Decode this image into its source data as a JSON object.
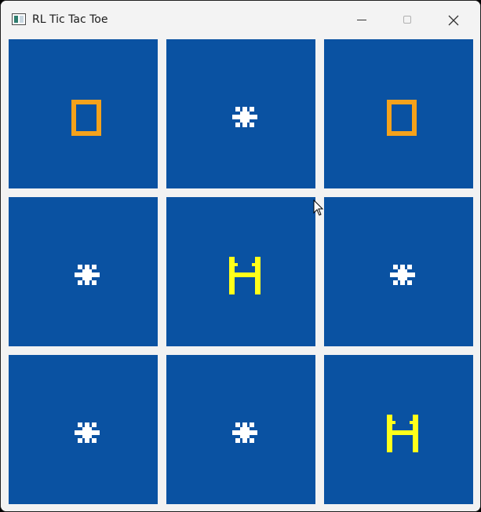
{
  "window": {
    "title": "RL Tic Tac Toe",
    "icon": "app-window-icon",
    "controls": [
      "minimize-icon",
      "maximize-icon",
      "close-icon"
    ]
  },
  "colors": {
    "cell_background": "#0a52a2",
    "board_background": "#f2f2f2",
    "mark_orange": "#f5a21b",
    "mark_yellow": "#ffff1a",
    "mark_white": "#ffffff"
  },
  "board": {
    "cells": [
      {
        "row": 1,
        "col": 1,
        "icon": "orange-square-icon"
      },
      {
        "row": 1,
        "col": 2,
        "icon": "white-asterisk-icon"
      },
      {
        "row": 1,
        "col": 3,
        "icon": "orange-square-icon"
      },
      {
        "row": 2,
        "col": 1,
        "icon": "white-asterisk-icon"
      },
      {
        "row": 2,
        "col": 2,
        "icon": "yellow-h-icon"
      },
      {
        "row": 2,
        "col": 3,
        "icon": "white-asterisk-icon"
      },
      {
        "row": 3,
        "col": 1,
        "icon": "white-asterisk-icon"
      },
      {
        "row": 3,
        "col": 2,
        "icon": "white-asterisk-icon"
      },
      {
        "row": 3,
        "col": 3,
        "icon": "yellow-h-icon"
      }
    ]
  }
}
